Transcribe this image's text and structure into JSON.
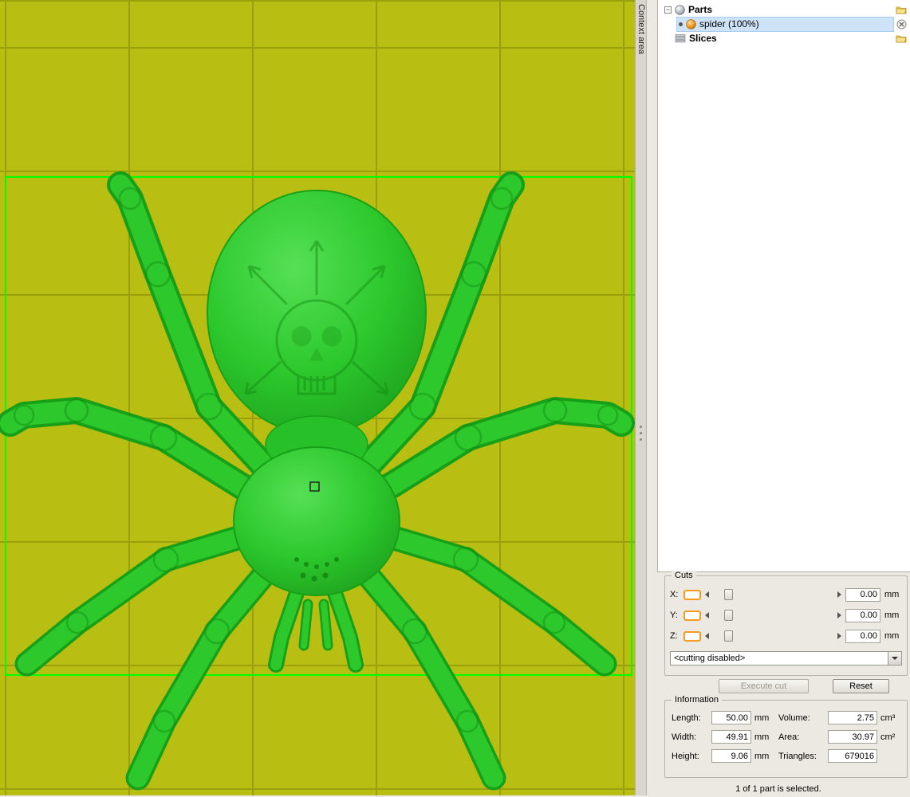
{
  "context_strip": {
    "label": "Context area"
  },
  "tree": {
    "parts": {
      "label": "Parts"
    },
    "spider": {
      "label": "spider (100%)"
    },
    "slices": {
      "label": "Slices"
    }
  },
  "cuts": {
    "title": "Cuts",
    "axes": [
      {
        "label": "X:",
        "value": "0.00",
        "unit": "mm"
      },
      {
        "label": "Y:",
        "value": "0.00",
        "unit": "mm"
      },
      {
        "label": "Z:",
        "value": "0.00",
        "unit": "mm"
      }
    ],
    "mode": "<cutting disabled>",
    "execute_label": "Execute cut",
    "reset_label": "Reset"
  },
  "information": {
    "title": "Information",
    "fields": [
      {
        "label": "Length:",
        "value": "50.00",
        "unit": "mm"
      },
      {
        "label": "Width:",
        "value": "49.91",
        "unit": "mm"
      },
      {
        "label": "Height:",
        "value": "9.06",
        "unit": "mm"
      },
      {
        "label": "Volume:",
        "value": "2.75",
        "unit": "cm³"
      },
      {
        "label": "Area:",
        "value": "30.97",
        "unit": "cm²"
      },
      {
        "label": "Triangles:",
        "value": "679016",
        "unit": ""
      }
    ]
  },
  "status": "1 of 1 part is selected.",
  "colors": {
    "plate": "#b8be12",
    "grid": "#9aa00c",
    "model": "#2cc82c",
    "model-dark": "#17a017",
    "selection": "#00ff00",
    "accent-orange": "#f59a23",
    "tree-selection": "#cfe3f8"
  }
}
